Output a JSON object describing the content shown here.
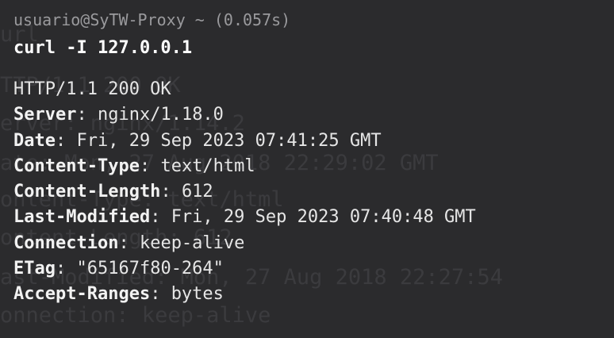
{
  "prompt": {
    "user_host": "usuario@SyTW-Proxy",
    "cwd": "~",
    "duration": "(0.057s)"
  },
  "command": "curl -I 127.0.0.1",
  "status_line": "HTTP/1.1 200 OK",
  "headers": [
    {
      "key": "Server",
      "value": "nginx/1.18.0"
    },
    {
      "key": "Date",
      "value": "Fri, 29 Sep 2023 07:41:25 GMT"
    },
    {
      "key": "Content-Type",
      "value": "text/html"
    },
    {
      "key": "Content-Length",
      "value": "612"
    },
    {
      "key": "Last-Modified",
      "value": "Fri, 29 Sep 2023 07:40:48 GMT"
    },
    {
      "key": "Connection",
      "value": "keep-alive"
    },
    {
      "key": "ETag",
      "value": "\"65167f80-264\""
    },
    {
      "key": "Accept-Ranges",
      "value": "bytes"
    }
  ],
  "ghost_lines": [
    "url",
    "TTP/1.1 200 OK",
    "erver: nginx/1.14.2",
    "ate: Mon, 27 Aug 2018 22:29:02 GMT",
    "ontent-Type: text/html",
    "ontent-Length: 612",
    "ast-Modified: Mon, 27 Aug 2018 22:27:54",
    "onnection: keep-alive"
  ],
  "colors": {
    "background": "#2b2b2d",
    "prompt": "#9a9a9d",
    "command": "#ffffff",
    "output": "#e6e6e6",
    "ghost": "#3b3b3e"
  }
}
